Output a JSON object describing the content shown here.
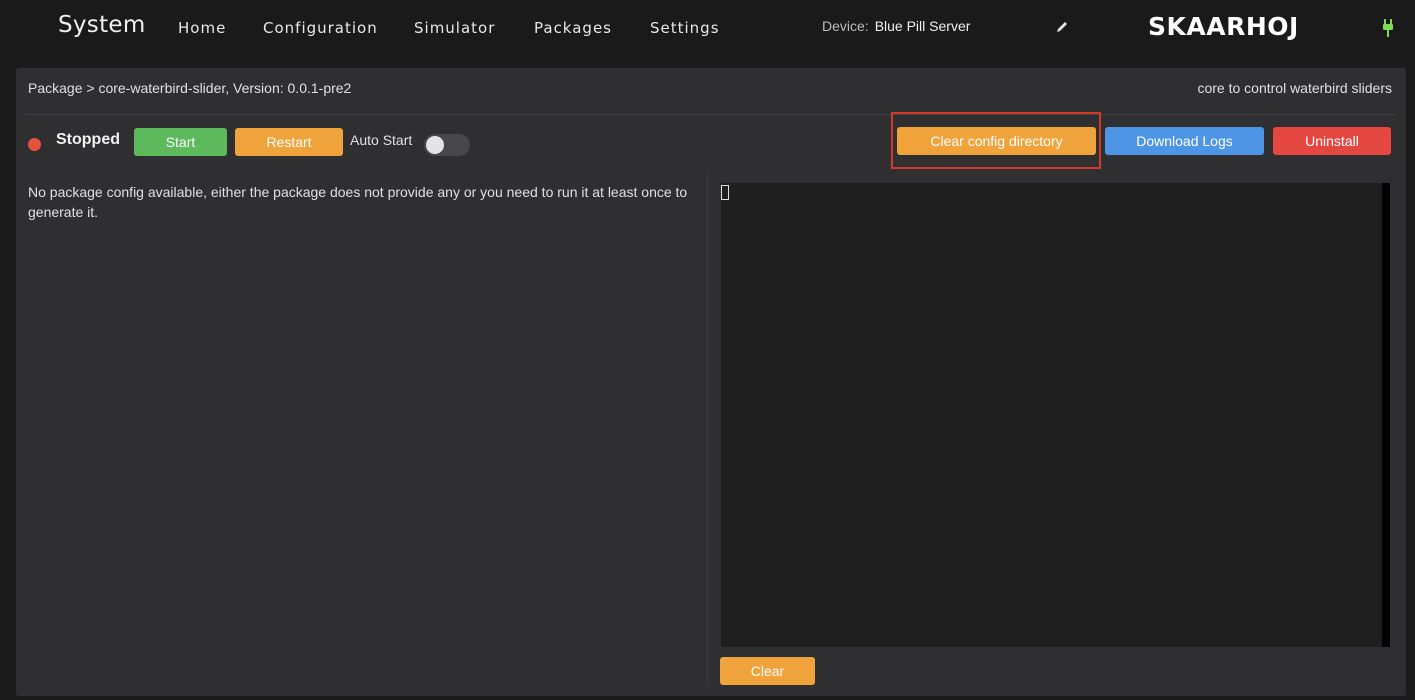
{
  "nav": {
    "brand": "System",
    "items": [
      "Home",
      "Configuration",
      "Simulator",
      "Packages",
      "Settings"
    ],
    "device_label": "Device:",
    "device_name": "Blue Pill Server",
    "logo": "SKAARHOJ",
    "edit_icon": "pencil-icon",
    "power_icon": "power-plug-icon"
  },
  "package": {
    "breadcrumb": "Package > core-waterbird-slider, Version: 0.0.1-pre2",
    "description": "core to control waterbird sliders",
    "status": "Stopped",
    "auto_start_label": "Auto Start",
    "auto_start_on": false,
    "config_note": "No package config available, either the package does not provide any or you need to run it at least once to generate it."
  },
  "buttons": {
    "start": "Start",
    "restart": "Restart",
    "clear_config": "Clear config directory",
    "download_logs": "Download Logs",
    "uninstall": "Uninstall",
    "clear": "Clear"
  },
  "colors": {
    "status_stopped": "#e5533f",
    "green": "#5cb95c",
    "orange": "#f0a33a",
    "blue": "#4e95e6",
    "red": "#e4473f",
    "highlight": "#d43a27"
  }
}
